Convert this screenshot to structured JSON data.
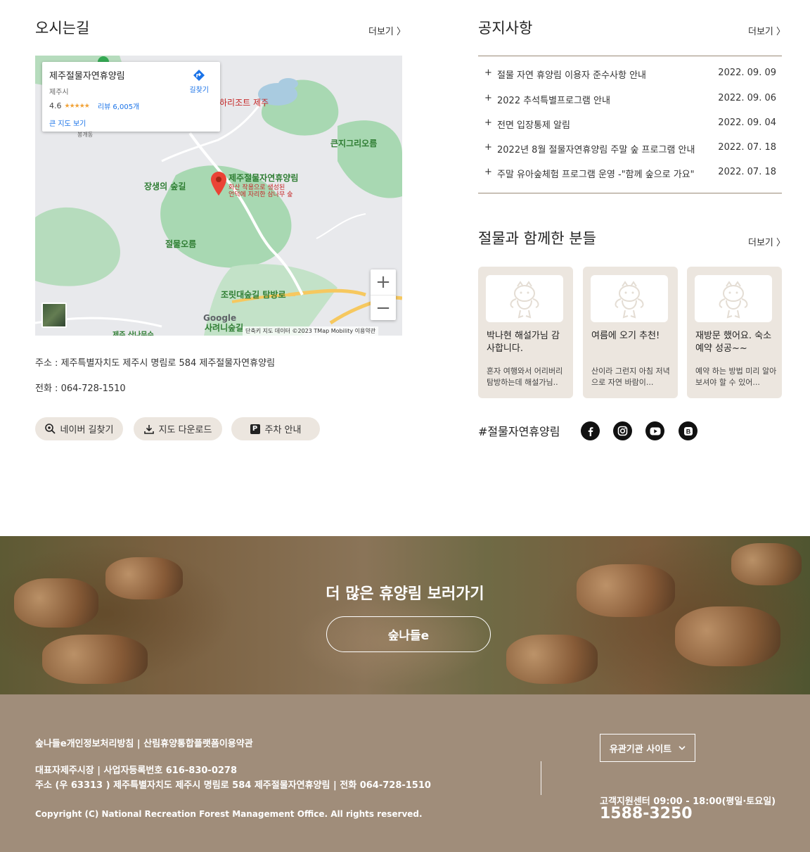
{
  "directions": {
    "title": "오시는길",
    "more": "더보기 〉",
    "map": {
      "card_name": "제주절물자연휴양림",
      "card_city": "제주시",
      "rating": "4.6",
      "stars": "★★★★★",
      "reviews": "리뷰 6,005개",
      "big_map": "큰 지도 보기",
      "directions_label": "길찾기",
      "labels": {
        "place_name": "제주절물자연휴양림",
        "place_desc1": "화산 작용으로 생성된",
        "place_desc2": "언덕에 자리한 삼나무 숲",
        "resort": "하리조트 제주",
        "big_oreum": "큰지그리오름",
        "jangsaeng": "장생의 숲길",
        "jeolmul_oreum": "절물오름",
        "jorit": "조릿대숲길 탐방로",
        "saryeoni": "사려니숲길",
        "bongae": "봉개동",
        "bottom_left": "제주 산나무수"
      },
      "google": "Google",
      "attribution": "단축키   지도 데이터 ©2023 TMap Mobility   이용약관"
    },
    "address": "주소 : 제주특별자치도 제주시 명림로 584 제주절물자연휴양림",
    "phone": "전화 : 064-728-1510",
    "buttons": {
      "naver": "네이버 길찾기",
      "download": "지도 다운로드",
      "parking": "주차 안내"
    }
  },
  "notices": {
    "title": "공지사항",
    "more": "더보기 〉",
    "items": [
      {
        "title": "절물 자연 휴양림 이용자 준수사항 안내",
        "date": "2022. 09. 09"
      },
      {
        "title": "2022 추석특별프로그램 안내",
        "date": "2022. 09. 06"
      },
      {
        "title": "전면 입장통제 알림",
        "date": "2022. 09. 04"
      },
      {
        "title": "2022년 8월 절물자연휴양림 주말 숲 프로그램 안내",
        "date": "2022. 07. 18"
      },
      {
        "title": "주말 유아숲체험 프로그램 운영 -\"함께 숲으로 가요\"",
        "date": "2022. 07. 18"
      }
    ]
  },
  "reviews": {
    "title": "절물과 함께한 분들",
    "more": "더보기 〉",
    "items": [
      {
        "title": "박나현 해설가님 감사합니다.",
        "text": "혼자 여행와서 어리버리 탐방하는데 해설가님.."
      },
      {
        "title": "여름에 오기 추천!",
        "text": "산이라 그런지 아침 저녁으로 자연 바람이..."
      },
      {
        "title": "재방문 했어요. 숙소 예약 성공~~",
        "text": "예약 하는 방법 미리 알아보셔야 할 수 있어..."
      }
    ]
  },
  "social": {
    "hashtag": "#절물자연휴양림",
    "icons": [
      "facebook-icon",
      "instagram-icon",
      "youtube-icon",
      "blog-icon"
    ]
  },
  "banner": {
    "title": "더 많은 휴양림 보러가기",
    "button": "숲나들e"
  },
  "footer": {
    "policy": "숲나들e개인정보처리방침",
    "terms": "산림휴양통합플랫폼이용약관",
    "sep": " | ",
    "line1": "대표자제주시장 | 사업자등록번호 616-830-0278",
    "line2": "주소 (우 63313 ) 제주특별자치도 제주시 명림로 584 제주절물자연휴양림 | 전화 064-728-1510",
    "copyright": "Copyright (C) National Recreation Forest Management Office. All rights reserved.",
    "related": "유관기관 사이트",
    "cs_hours": "고객지원센터 09:00 - 18:00(평일·토요일)",
    "cs_phone": "1588-3250"
  },
  "colors": {
    "beige": "#ece6df",
    "footer": "#a08d7a",
    "line": "#9a8a76"
  }
}
